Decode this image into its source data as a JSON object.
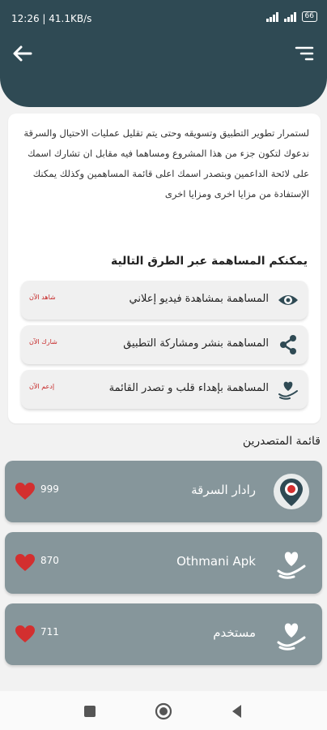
{
  "status_bar": {
    "time": "12:26 | 41.1KB/s",
    "battery": "66"
  },
  "intro_text": "لستمرار تطوير التطبيق وتسويقه وحتى يتم تقليل عمليات الاحتيال والسرقة ندعوك لتكون جزء من هذا المشروع ومساهما فيه مقابل ان تشارك اسمك على لائحة الداعمين وبتصدر اسمك اعلى قائمة المساهمين وكذلك يمكنك الإستفادة من مزايا اخرى ومزايا اخرى",
  "contrib_title": "يمكنكم المساهمة عبر الطرق التالية",
  "options": [
    {
      "label": "المساهمة بمشاهدة فيديو إعلاني",
      "cta": "شاهد الآن",
      "icon": "eye-icon"
    },
    {
      "label": "المساهمة بنشر ومشاركة التطبيق",
      "cta": "شارك الآن",
      "icon": "share-icon"
    },
    {
      "label": "المساهمة بإهداء قلب و تصدر القائمة",
      "cta": "إدعم الآن",
      "icon": "heart-hand-icon"
    }
  ],
  "leaders_title": "قائمة المتصدرين",
  "leaders": [
    {
      "name": "رادار السرقة",
      "count": "999",
      "avatar": "radar-icon"
    },
    {
      "name": "Othmani Apk",
      "count": "870",
      "avatar": "heart-hand-icon"
    },
    {
      "name": "مستخدم",
      "count": "711",
      "avatar": "heart-hand-icon"
    }
  ],
  "colors": {
    "header": "#2f4a54",
    "leader_card": "#86969b",
    "heart": "#d32f2f",
    "cta": "#c62828"
  }
}
